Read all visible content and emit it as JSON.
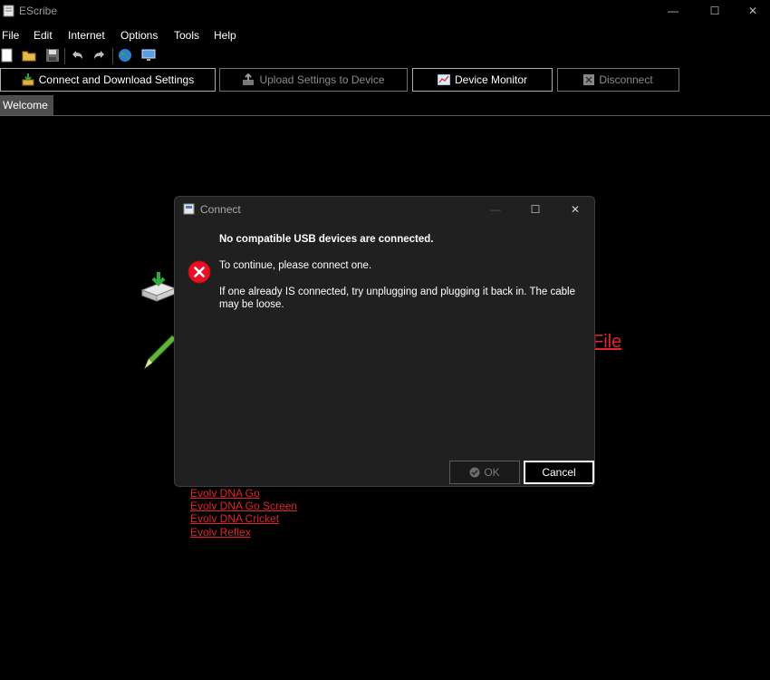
{
  "window": {
    "title": "EScribe",
    "minimize_glyph": "—",
    "maximize_glyph": "☐",
    "close_glyph": "✕"
  },
  "menu": [
    "File",
    "Edit",
    "Internet",
    "Options",
    "Tools",
    "Help"
  ],
  "toolbar": {
    "icons": [
      "new-icon",
      "open-folder-icon",
      "save-icon",
      "undo-icon",
      "redo-icon",
      "globe-icon",
      "monitor-icon"
    ]
  },
  "buttons": {
    "connect": "Connect and Download Settings",
    "upload": "Upload Settings to Device",
    "monitor": "Device Monitor",
    "disconnect": "Disconnect"
  },
  "tabs": {
    "welcome": "Welcome"
  },
  "background_links": {
    "file_partial": "File",
    "devices": [
      "Evolv DNA Go",
      "Evolv DNA Go Screen",
      "Evolv DNA Cricket",
      "Evolv Reflex"
    ]
  },
  "dialog": {
    "title": "Connect",
    "heading": "No compatible USB devices are connected.",
    "line1": "To continue, please connect one.",
    "line2": "If one already IS connected, try unplugging and plugging it back in. The cable may be loose.",
    "ok": "OK",
    "cancel": "Cancel"
  },
  "colors": {
    "link_red": "#e0242c",
    "error_red": "#e81123",
    "background": "#000000",
    "dialog_bg": "#202020"
  }
}
